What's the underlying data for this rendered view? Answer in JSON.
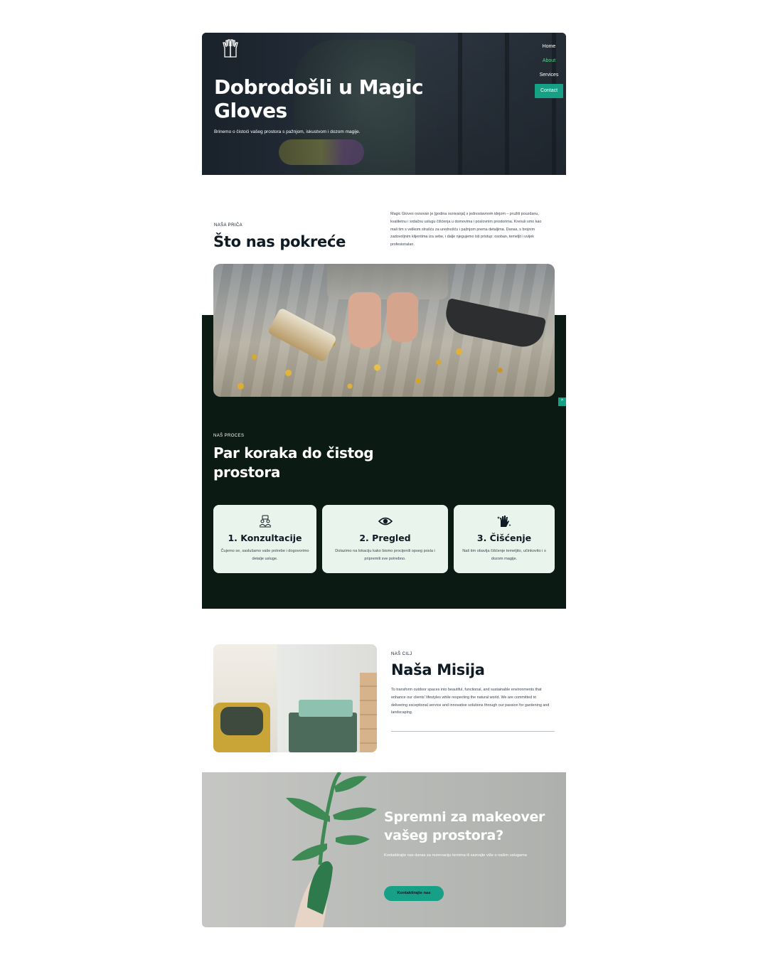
{
  "nav": {
    "items": [
      {
        "label": "Home"
      },
      {
        "label": "About"
      },
      {
        "label": "Services"
      },
      {
        "label": "Contact"
      }
    ]
  },
  "hero": {
    "title": "Dobrodošli u Magic Gloves",
    "subtitle": "Brinemo o čistoći vašeg prostora s pažnjom, iskustvom i dozom magije."
  },
  "story": {
    "eyebrow": "NAŠA PRIČA",
    "title": "Što nas pokreće",
    "text": "Magic Gloves osnovan je [godina osnivanja] s jednostavnom idejom – pružiti pouzdanu, kvalitetnu i srdačnu uslugu čišćenja u domovima i poslovnim prostorima. Krenuli smo kao mali tim s velikom strašću za urednošću i pažnjom prema detaljima. Danas, s brojnim zadovoljnim klijentima iza sebe, i dalje njegujemo isti pristup: osoban, temeljit i uvijek profesionalan."
  },
  "process": {
    "eyebrow": "NAŠ PROCES",
    "title": "Par koraka do čistog prostora",
    "steps": [
      {
        "icon": "consultation-icon",
        "title": "1. Konzultacije",
        "text": "Čujemo se, saslušamo vaše potrebe i dogovorimo detalje usluge."
      },
      {
        "icon": "eye-icon",
        "title": "2. Pregled",
        "text": "Dolazimo na lokaciju kako bismo procijenili opseg posla i pripremili sve potrebno."
      },
      {
        "icon": "glove-sparkle-icon",
        "title": "3. Čišćenje",
        "text": "Naš tim obavlja čišćenje temeljito, učinkovito i s dozom magije."
      }
    ]
  },
  "mission": {
    "eyebrow": "NAŠ CILJ",
    "title": "Naša Misija",
    "text": "To transform outdoor spaces into beautiful, functional, and sustainable environments that enhance our clients' lifestyles while respecting the natural world. We are committed to delivering exceptional service and innovative solutions through our passion for gardening and landscaping."
  },
  "cta": {
    "title": "Spremni za makeover vašeg prostora?",
    "text": "Kontaktirajte nas danas za rezervaciju termina ili saznajte više o našim uslugama",
    "button": "Kontaktirajte nas"
  },
  "scroll_top": "^",
  "colors": {
    "accent": "#16a085",
    "dark_section": "#0b1a12",
    "card_bg": "#e9f4ec",
    "nav_active": "#5fd08c"
  }
}
